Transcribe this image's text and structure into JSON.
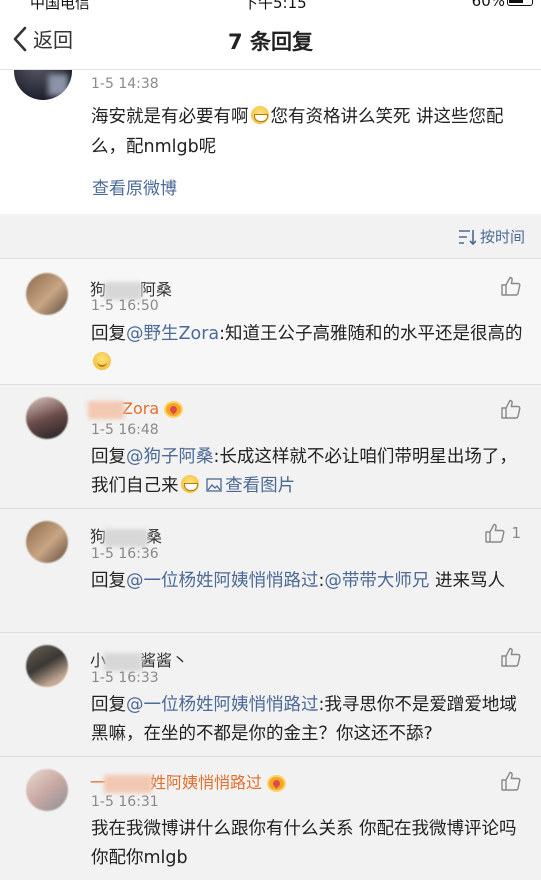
{
  "status_bar": {
    "carrier": "中国电信",
    "time": "下午5:15",
    "battery": "60%"
  },
  "nav": {
    "back_label": "返回",
    "title": "7 条回复"
  },
  "original": {
    "time": "1-5 14:38",
    "text_before": "海安就是有必要有啊",
    "text_after": "您有资格讲么笑死 讲这些您配么，配nmlgb呢",
    "view_original": "查看原微博"
  },
  "sort": {
    "label": "按时间"
  },
  "replies": [
    {
      "name_prefix": "狗",
      "name_suffix": "阿桑",
      "time": "1-5 16:50",
      "reply_prefix": "回复",
      "mention": "@野生Zora",
      "text": ":知道王公子高雅随和的水平还是很高的"
    },
    {
      "name_suffix": "Zora",
      "time": "1-5 16:48",
      "reply_prefix": "回复",
      "mention": "@狗子阿桑",
      "text": ":长成这样就不必让咱们带明星出场了，我们自己来",
      "image_link": "查看图片"
    },
    {
      "name_prefix": "狗",
      "name_suffix": "桑",
      "time": "1-5 16:36",
      "reply_prefix": "回复",
      "mention": "@一位杨姓阿姨悄悄路过",
      "mention2": "@带带大师兄",
      "text_mid": ":",
      "text": " 进来骂人",
      "likes": "1"
    },
    {
      "name_prefix": "小",
      "name_suffix": "酱酱丶",
      "time": "1-5 16:33",
      "reply_prefix": "回复",
      "mention": "@一位杨姓阿姨悄悄路过",
      "text": ":我寻思你不是爱蹭爱地域黑嘛，在坐的不都是你的金主？你这还不舔?"
    },
    {
      "name_prefix": "一",
      "name_suffix": "姓阿姨悄悄路过",
      "time": "1-5 16:31",
      "text": "我在我微博讲什么跟你有什么关系 你配在我微博评论吗 你配你mlgb"
    }
  ],
  "colors": {
    "link": "#4b6a97",
    "vip_name": "#e36f2e",
    "bg": "#f2f2f2"
  },
  "icons": [
    "back-chevron-icon",
    "sort-icon",
    "thumb-up-icon",
    "crown-badge-icon",
    "grin-emoji-icon",
    "smile-emoji-icon",
    "image-icon"
  ]
}
